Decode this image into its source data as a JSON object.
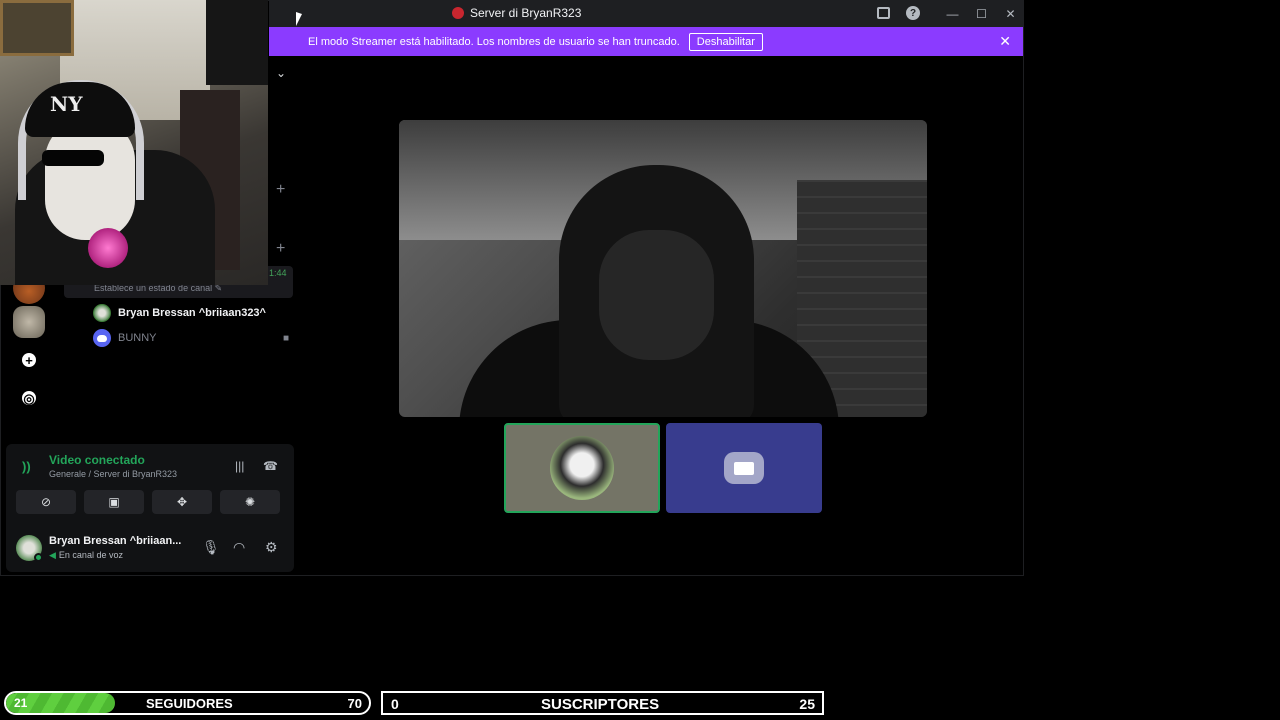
{
  "window": {
    "title": "Server di BryanR323",
    "icons": [
      "server-logo-icon",
      "inbox-icon",
      "help-icon",
      "minimize-icon",
      "maximize-icon",
      "close-icon"
    ]
  },
  "notice": {
    "text": "El modo Streamer está habilitado. Los nombres de usuario se han truncado.",
    "button_label": "Deshabilitar",
    "accent": "#8b3bff"
  },
  "channel": {
    "time_suffix": "1:44",
    "status_placeholder": "Establece un estado de canal",
    "members": [
      {
        "name": "Bryan Bressan ^briiaan323^",
        "muted": false
      },
      {
        "name": "BUNNY",
        "muted": true
      }
    ]
  },
  "voice": {
    "status_title": "Video conectado",
    "location": "Generale / Server di BryanR323",
    "status_color": "#23a55a",
    "actions": [
      "camera-off-icon",
      "screen-share-icon",
      "activities-icon",
      "soundboard-icon"
    ]
  },
  "user": {
    "name": "Bryan Bressan ^briiaan...",
    "status": "En canal de voz"
  },
  "goals": {
    "followers": {
      "current": "21",
      "label": "SEGUIDORES",
      "goal": "70",
      "progress_pct": 30
    },
    "subs": {
      "current": "0",
      "label": "SUSCRIPTORES",
      "goal": "25"
    }
  }
}
